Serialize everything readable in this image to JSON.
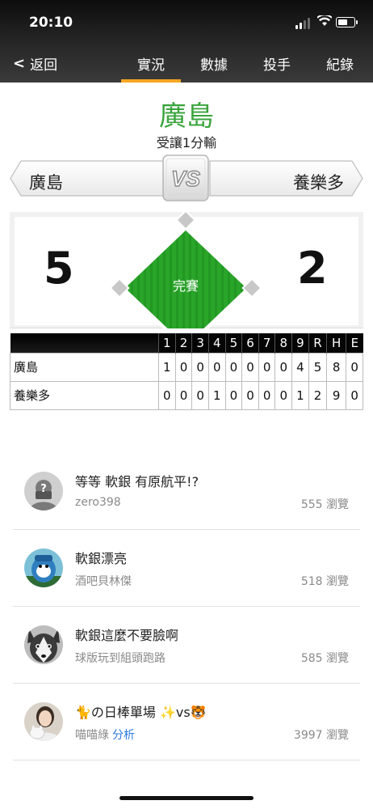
{
  "status_bar": {
    "time": "20:10"
  },
  "nav": {
    "back_label": "返回",
    "tabs": [
      "實況",
      "數據",
      "投手",
      "紀錄"
    ],
    "active_tab": "實況"
  },
  "result": {
    "winner": "廣島",
    "handicap": "受讓1分輸"
  },
  "matchup": {
    "home": "廣島",
    "away": "養樂多",
    "vs": "VS"
  },
  "score": {
    "home": "5",
    "away": "2",
    "status": "完賽"
  },
  "linescore": {
    "headers": [
      "1",
      "2",
      "3",
      "4",
      "5",
      "6",
      "7",
      "8",
      "9",
      "R",
      "H",
      "E"
    ],
    "rows": [
      {
        "team": "廣島",
        "cells": [
          "1",
          "0",
          "0",
          "0",
          "0",
          "0",
          "0",
          "0",
          "4",
          "5",
          "8",
          "0"
        ]
      },
      {
        "team": "養樂多",
        "cells": [
          "0",
          "0",
          "0",
          "1",
          "0",
          "0",
          "0",
          "0",
          "1",
          "2",
          "9",
          "0"
        ]
      }
    ]
  },
  "articles": [
    {
      "title": "等等 軟銀 有原航平!?",
      "author": "zero398",
      "tag": "",
      "views": "555 瀏覽",
      "avatar": "mystery-avatar"
    },
    {
      "title": "軟銀漂亮",
      "author": "酒吧貝林傑",
      "tag": "",
      "views": "518 瀏覽",
      "avatar": "mascot-avatar"
    },
    {
      "title": "軟銀這麼不要臉啊",
      "author": "球版玩到組頭跑路",
      "tag": "",
      "views": "585 瀏覽",
      "avatar": "husky-avatar"
    },
    {
      "title": "🐈の日棒單場 ✨vs🐯",
      "author": "喵喵綠",
      "tag": "分析",
      "views": "3997 瀏覽",
      "avatar": "person-cat-avatar"
    }
  ],
  "colors": {
    "accent": "#f5a623",
    "winner": "#3aa43c",
    "field": "#2aa52a",
    "link": "#2a7ae2"
  }
}
